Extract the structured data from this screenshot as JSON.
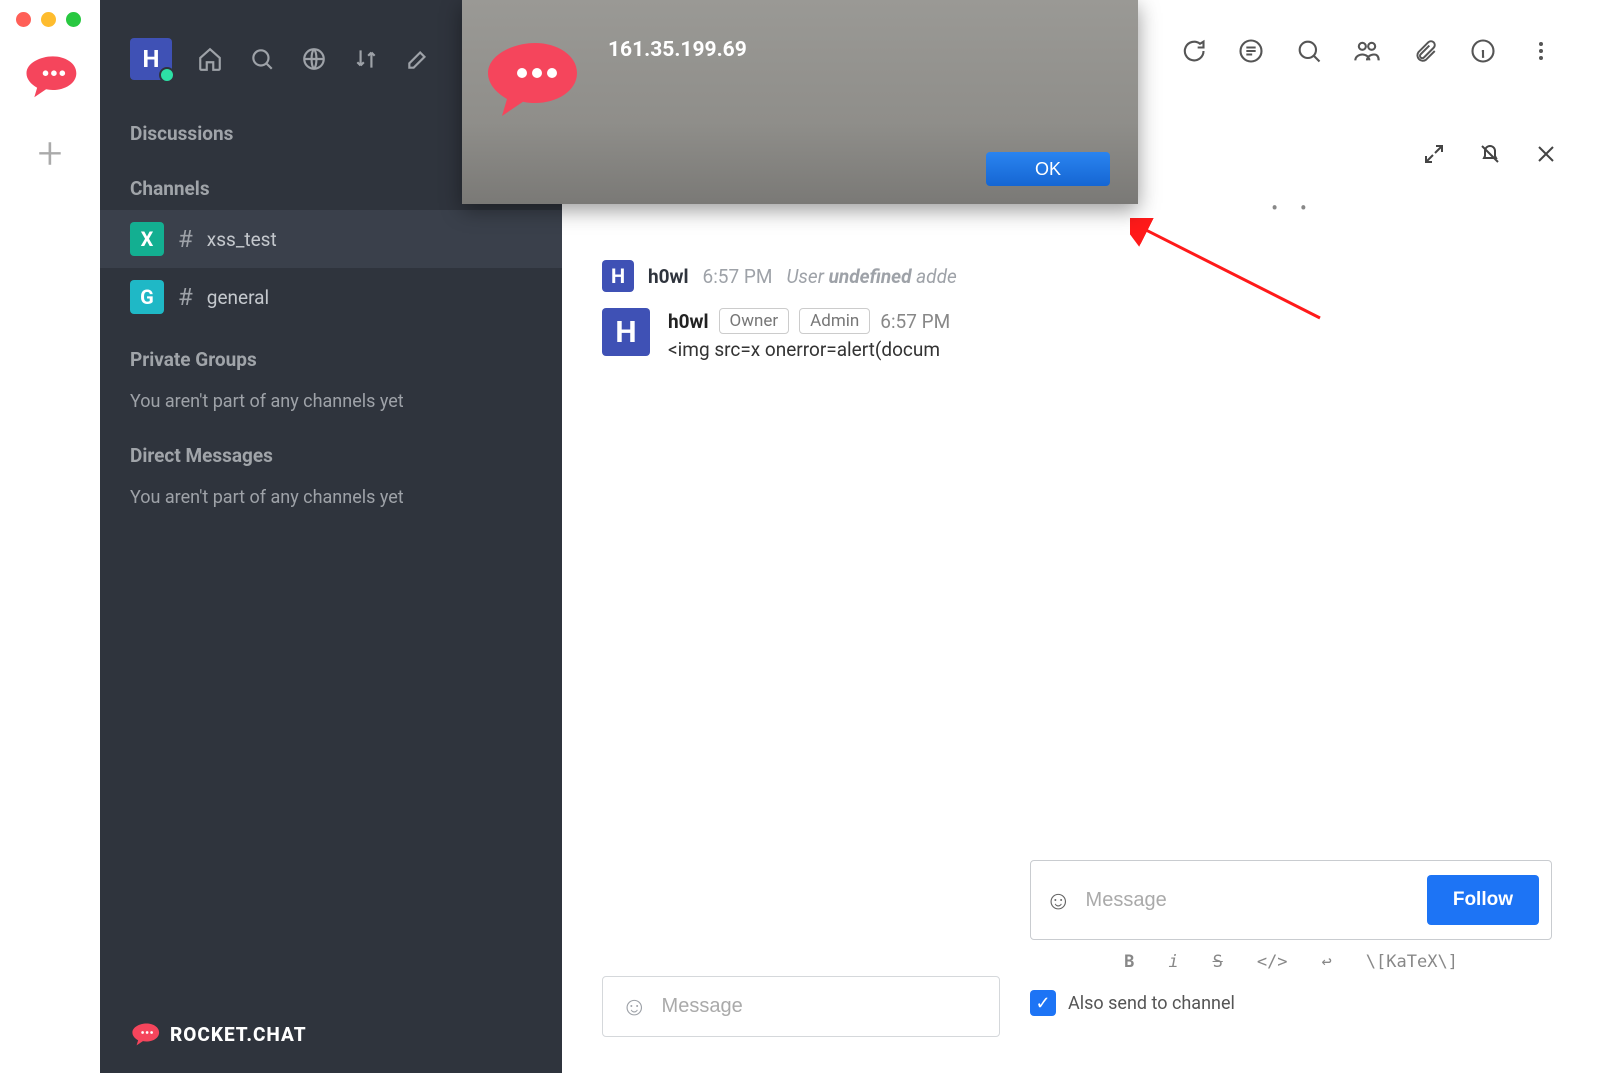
{
  "dialog": {
    "title": "161.35.199.69",
    "ok": "OK"
  },
  "sidebar": {
    "statusLetter": "H",
    "sections": {
      "discussions": {
        "heading": "Discussions"
      },
      "channels": {
        "heading": "Channels",
        "items": [
          {
            "avatarLetter": "X",
            "avatarColor": "#13af91",
            "name": "xss_test",
            "selected": true
          },
          {
            "avatarLetter": "G",
            "avatarColor": "#1fb8c6",
            "name": "general",
            "selected": false
          }
        ]
      },
      "privateGroups": {
        "heading": "Private Groups",
        "empty": "You aren't part of any channels yet"
      },
      "directMessages": {
        "heading": "Direct Messages",
        "empty": "You aren't part of any channels yet"
      }
    },
    "brand": "ROCKET.CHAT"
  },
  "main": {
    "system": {
      "avatar": "H",
      "user": "h0wl",
      "time": "6:57 PM",
      "textPre": "User ",
      "textBold": "undefined",
      "textPost": " adde"
    },
    "message": {
      "avatar": "H",
      "user": "h0wl",
      "roles": [
        "Owner",
        "Admin"
      ],
      "time": "6:57 PM",
      "body": "<img src=x onerror=alert(docum"
    },
    "compose": {
      "placeholder": "Message"
    }
  },
  "thread": {
    "compose": {
      "placeholder": "Message",
      "follow": "Follow"
    },
    "formatting": {
      "b": "B",
      "i": "i",
      "s": "S",
      "code": "</>",
      "newline": "↩",
      "katex": "\\[KaTeX\\]"
    },
    "alsoSend": "Also send to channel"
  }
}
